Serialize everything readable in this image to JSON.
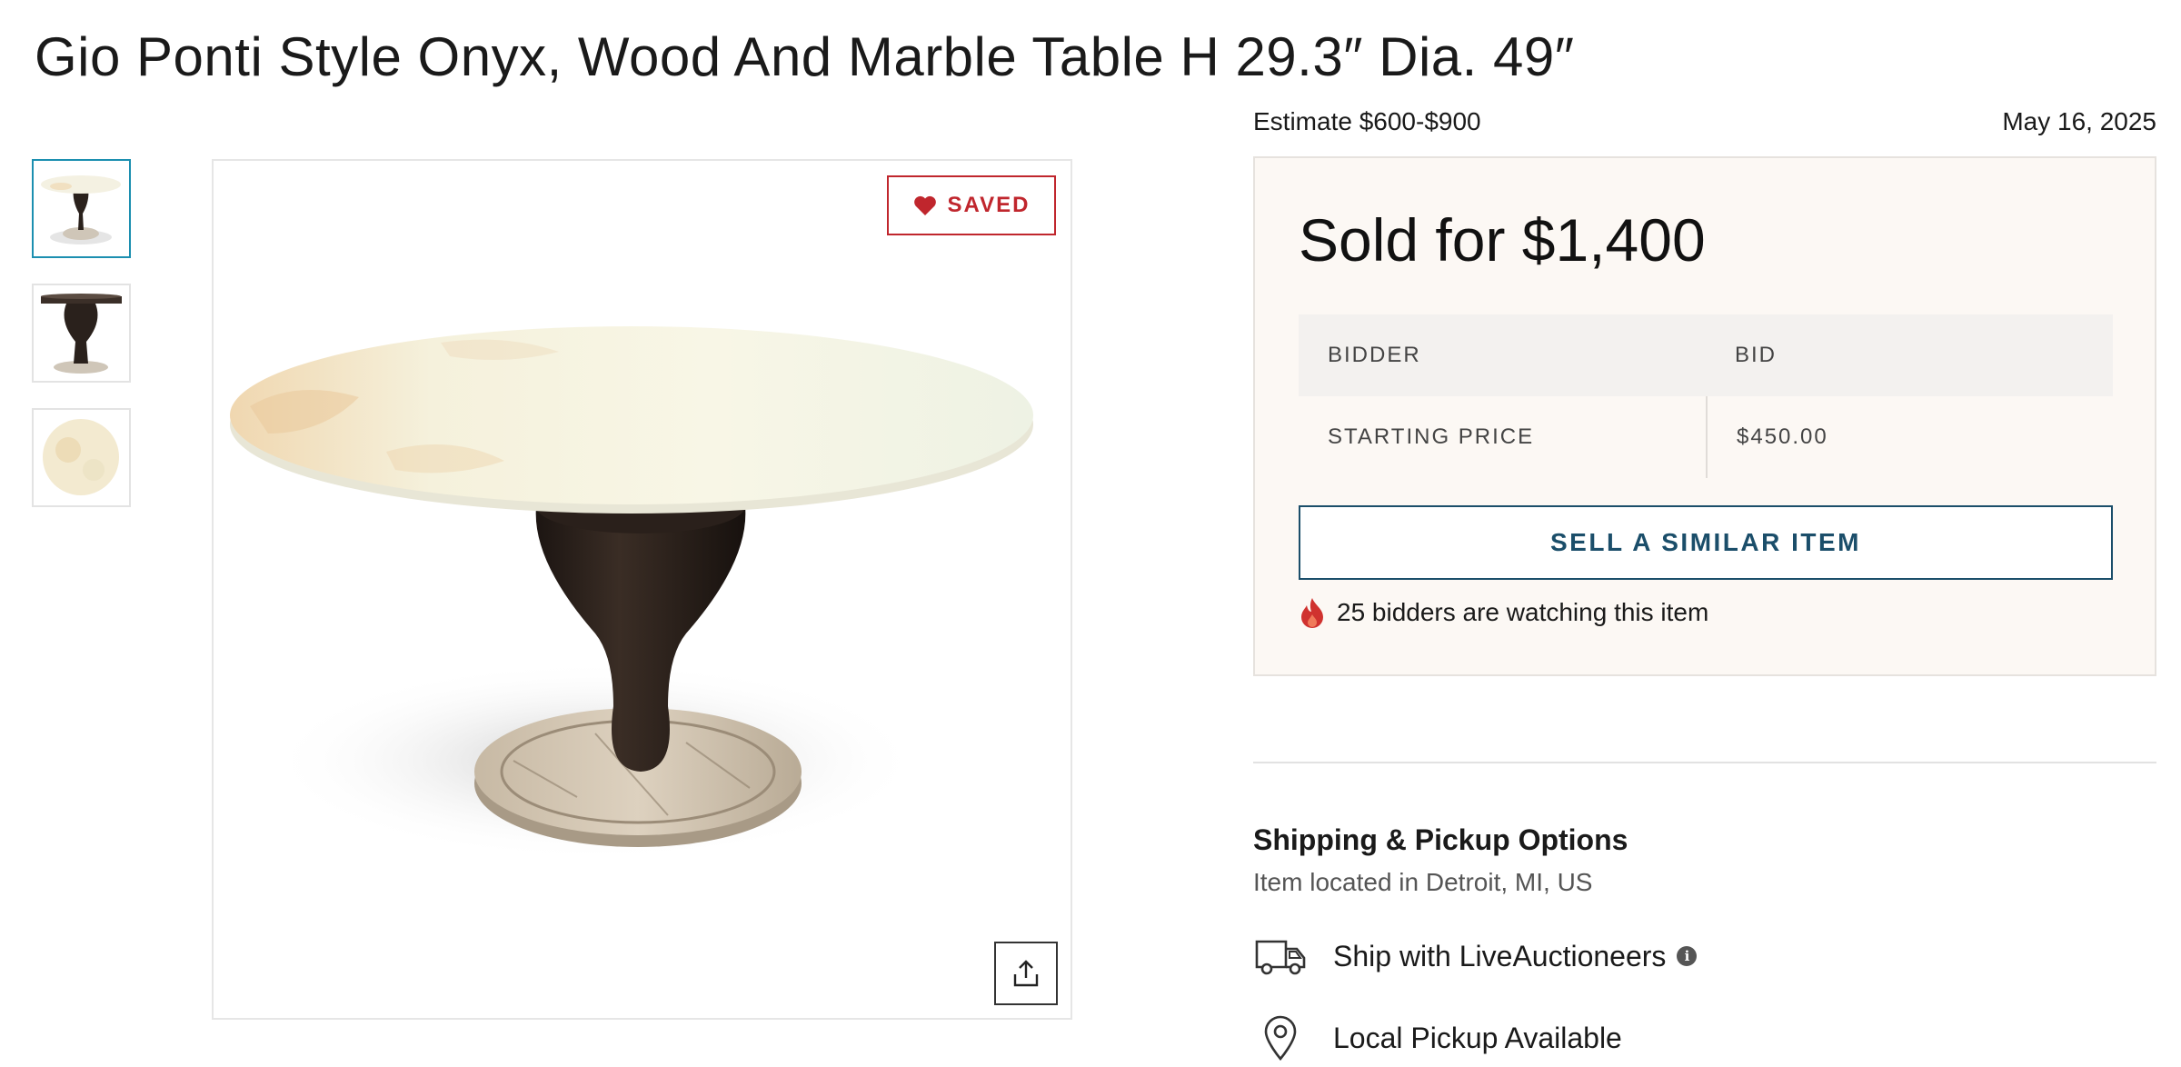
{
  "title": "Gio Ponti Style Onyx, Wood And Marble Table H 29.3″ Dia. 49″",
  "estimate": "Estimate $600-$900",
  "date": "May 16, 2025",
  "gallery": {
    "thumbnail_count": 3,
    "active_index": 0,
    "saved_label": "SAVED",
    "share_icon": "share-icon"
  },
  "bid_box": {
    "sold_for": "Sold for $1,400",
    "table": {
      "headers": [
        "BIDDER",
        "BID"
      ],
      "rows": [
        [
          "STARTING PRICE",
          "$450.00"
        ]
      ]
    },
    "sell_button": "SELL A SIMILAR ITEM",
    "watchers": "25 bidders are watching this item"
  },
  "shipping": {
    "title": "Shipping & Pickup Options",
    "location": "Item located in Detroit, MI, US",
    "options": [
      {
        "icon": "truck-icon",
        "label": "Ship with LiveAuctioneers",
        "info": "i"
      },
      {
        "icon": "location-pin-icon",
        "label": "Local Pickup Available"
      }
    ]
  },
  "colors": {
    "saved_red": "#c0262d",
    "button_blue": "#1b4e6a",
    "thumb_active": "#1c8fb0",
    "box_bg": "#fcf8f4"
  }
}
